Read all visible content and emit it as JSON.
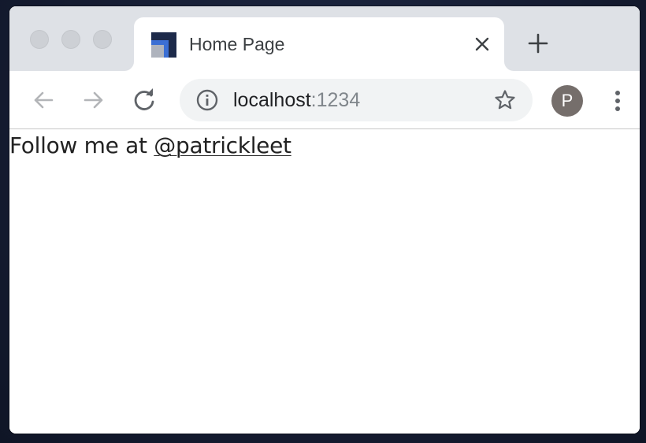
{
  "tab": {
    "title": "Home Page",
    "favicon": "parcel-logo-icon"
  },
  "toolbar": {
    "url_host": "localhost",
    "url_port": ":1234",
    "profile_initial": "P"
  },
  "page": {
    "text_prefix": "Follow me at",
    "link_text": "@patrickleet"
  },
  "colors": {
    "tabstrip_bg": "#dee1e6",
    "omnibox_bg": "#f1f3f4",
    "avatar_bg": "#756e6b",
    "favicon_blue": "#3b6fd4",
    "favicon_dark": "#1d2a4a"
  }
}
